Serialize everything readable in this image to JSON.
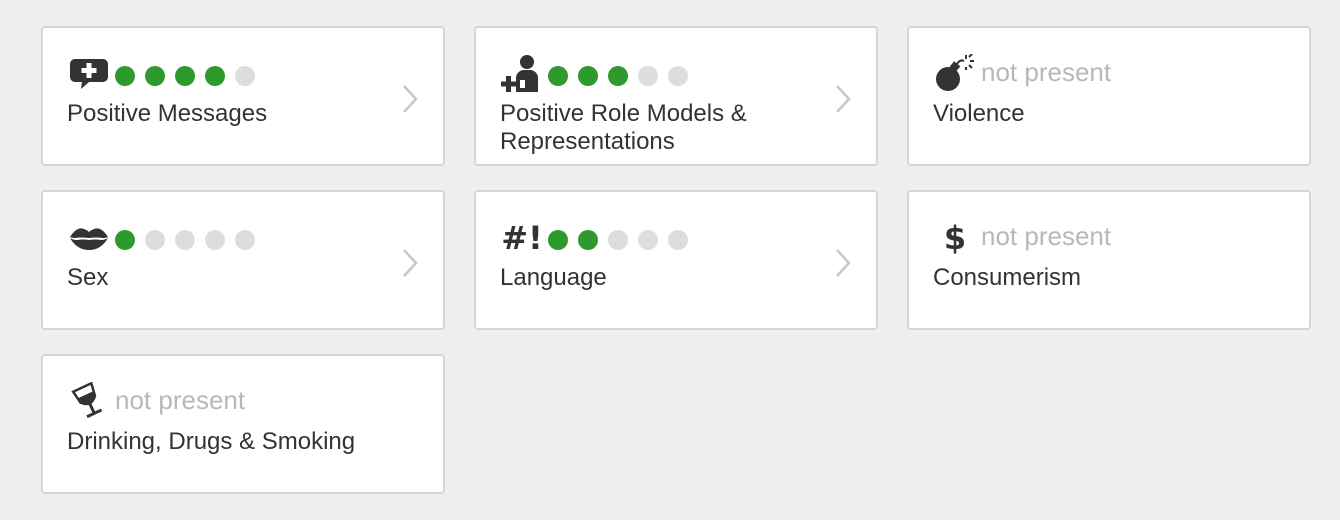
{
  "colors": {
    "dot_filled": "#2e9a2e",
    "dot_empty": "#dddddd",
    "not_present_text": "#b8b8b8",
    "card_border": "#d6d6d6",
    "page_background": "#efefef"
  },
  "cards": {
    "positive_messages": {
      "title": "Positive Messages",
      "icon": "speech-bubble-plus-icon",
      "rating": 4,
      "max_rating": 5,
      "has_details": true
    },
    "role_models": {
      "title": "Positive Role Models & Representations",
      "icon": "person-plus-icon",
      "rating": 3,
      "max_rating": 5,
      "has_details": true
    },
    "violence": {
      "title": "Violence",
      "icon": "bomb-icon",
      "status": "not present",
      "has_details": false
    },
    "sex": {
      "title": "Sex",
      "icon": "lips-icon",
      "rating": 1,
      "max_rating": 5,
      "has_details": true
    },
    "language": {
      "title": "Language",
      "icon": "hash-exclamation-icon",
      "icon_text": "#!",
      "rating": 2,
      "max_rating": 5,
      "has_details": true
    },
    "consumerism": {
      "title": "Consumerism",
      "icon": "dollar-sign-icon",
      "icon_text": "$",
      "status": "not present",
      "has_details": false
    },
    "drinking": {
      "title": "Drinking, Drugs & Smoking",
      "icon": "wine-glass-icon",
      "status": "not present",
      "has_details": false
    }
  }
}
